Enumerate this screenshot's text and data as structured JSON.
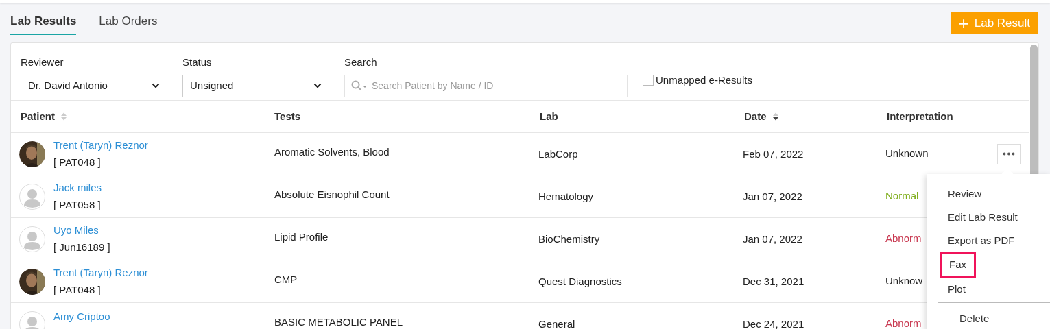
{
  "tabs": [
    {
      "label": "Lab Results",
      "selected": true
    },
    {
      "label": "Lab Orders",
      "selected": false
    }
  ],
  "add_button": {
    "icon": "+",
    "label": "Lab Result"
  },
  "filters": {
    "reviewer": {
      "label": "Reviewer",
      "value": "Dr. David Antonio"
    },
    "status": {
      "label": "Status",
      "value": "Unsigned"
    },
    "search": {
      "label": "Search",
      "placeholder": "Search Patient by Name / ID"
    },
    "unmapped": {
      "label": "Unmapped e-Results",
      "checked": false
    }
  },
  "table": {
    "columns": [
      {
        "label": "Patient",
        "sortable": true,
        "sorted_descending": false
      },
      {
        "label": "Tests"
      },
      {
        "label": "Lab"
      },
      {
        "label": "Date",
        "sortable": true,
        "sorted_descending": true
      },
      {
        "label": "Interpretation"
      }
    ],
    "rows": [
      {
        "patient": "Trent (Taryn) Reznor",
        "id": "[ PAT048 ]",
        "test": "Aromatic Solvents, Blood",
        "lab": "LabCorp",
        "date": "Feb 07, 2022",
        "interpretation": "Unknown",
        "color": "#222222",
        "menu_open": true
      },
      {
        "patient": "Jack miles",
        "id": "[ PAT058 ]",
        "avatar": {
          "kind": "placeholder"
        },
        "test": "Absolute Eisnophil Count",
        "lab": "Hematology",
        "date": "Jan 07, 2022",
        "interpretation": "Normal",
        "color": "#7fae1b"
      },
      {
        "patient": "Uyo Miles",
        "id": "[ Jun16189 ]",
        "avatar": {
          "kind": "placeholder"
        },
        "test": "Lipid Profile",
        "lab": "BioChemistry",
        "date": "Jan 07, 2022",
        "interpretation": "Abnorm",
        "color": "#c8374f"
      },
      {
        "patient": "Trent (Taryn) Reznor",
        "id": "[ PAT048 ]",
        "test": "CMP",
        "lab": "Quest Diagnostics",
        "date": "Dec 31, 2021",
        "interpretation": "Unknow",
        "color": "#222222"
      },
      {
        "patient": "Amy Criptoo",
        "avatar": {
          "kind": "placeholder"
        },
        "test": "BASIC METABOLIC PANEL",
        "lab": "General",
        "date": "Dec 24, 2021",
        "interpretation": "Abnorm",
        "color": "#c8374f"
      }
    ]
  },
  "row_menu": {
    "items": [
      {
        "label": "Review",
        "highlighted": false
      },
      {
        "label": "Edit Lab Result",
        "highlighted": false
      },
      {
        "label": "Export as PDF",
        "highlighted": false
      },
      {
        "label": "Fax",
        "highlighted": true
      },
      {
        "label": "Plot",
        "highlighted": false
      },
      {
        "label": "Delete",
        "highlighted": false,
        "divider_before": true
      }
    ]
  }
}
